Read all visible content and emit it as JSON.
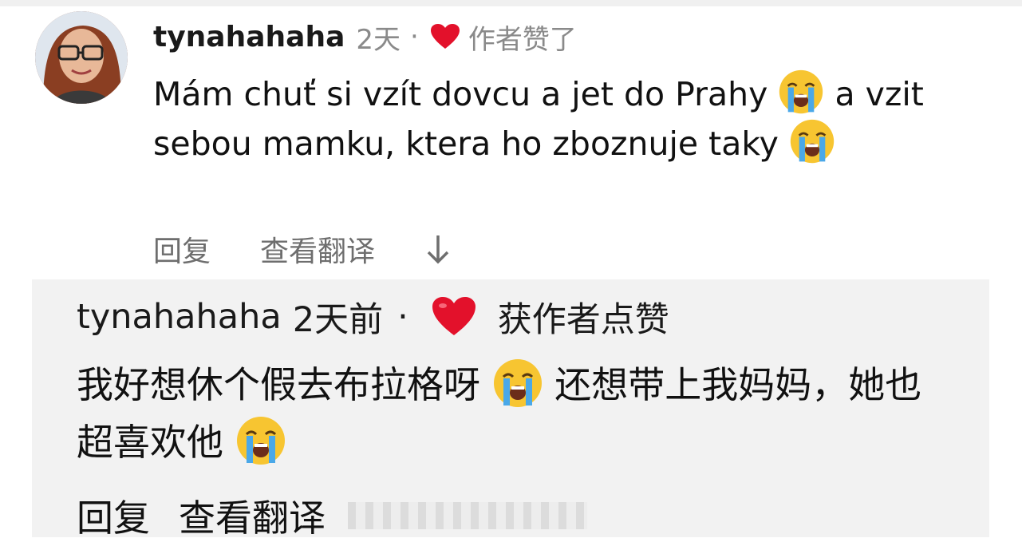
{
  "comment": {
    "username": "tynahahaha",
    "time": "2天",
    "separator": "·",
    "liked_label": "作者赞了",
    "text_part1": "Mám chuť si vzít dovcu a jet do Prahy",
    "text_part2": " a vzit sebou mamku, ktera ho zboznuje taky",
    "actions": {
      "reply": "回复",
      "translate": "查看翻译"
    }
  },
  "reply_card": {
    "username": "tynahahaha",
    "time": "2天前",
    "separator": "·",
    "liked_label": "获作者点赞",
    "text_part1": "我好想休个假去布拉格呀",
    "text_part2": " 还想带上我妈妈，她也超喜欢他",
    "actions": {
      "reply": "回复",
      "translate": "查看翻译"
    }
  },
  "icons": {
    "heart": "heart-icon",
    "emoji": "loudly-crying-face-icon",
    "arrow": "arrow-down-icon"
  },
  "colors": {
    "heart": "#e3112b",
    "muted_text": "#8a8a8a",
    "card_bg": "#f2f2f2",
    "emoji_yellow": "#f7c531",
    "tears": "#4aa8e8"
  }
}
